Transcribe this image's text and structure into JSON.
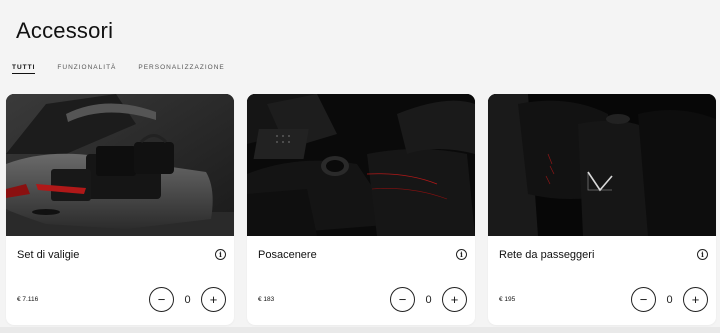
{
  "page": {
    "title": "Accessori"
  },
  "tabs": [
    {
      "label": "TUTTI",
      "active": true
    },
    {
      "label": "FUNZIONALITÀ",
      "active": false
    },
    {
      "label": "PERSONALIZZAZIONE",
      "active": false
    }
  ],
  "products": [
    {
      "name": "Set di valigie",
      "price": "€ 7.116",
      "quantity": "0",
      "image": "luggage-set-photo"
    },
    {
      "name": "Posacenere",
      "price": "€ 183",
      "quantity": "0",
      "image": "ashtray-photo"
    },
    {
      "name": "Rete da passeggeri",
      "price": "€ 195",
      "quantity": "0",
      "image": "passenger-net-photo"
    }
  ],
  "icons": {
    "info": "info-icon",
    "minus": "minus-icon",
    "plus": "plus-icon"
  },
  "glyphs": {
    "info": "i",
    "minus": "−",
    "plus": "+"
  },
  "colors": {
    "background": "#f4f4f4",
    "card": "#ffffff",
    "text": "#111111",
    "accent_red": "#b01818"
  }
}
